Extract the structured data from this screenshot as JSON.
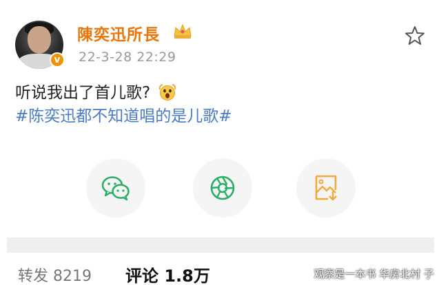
{
  "post": {
    "username": "陳奕迅所長",
    "timestamp": "22-3-28 22:29",
    "verified_mark": "v",
    "text": "听说我出了首儿歌?",
    "hashtag": "#陈奕迅都不知道唱的是儿歌#",
    "icons": {
      "vip": "crown-icon",
      "favorite": "star-icon",
      "emoji": "scream-emoji-icon"
    }
  },
  "share": [
    {
      "name": "wechat",
      "icon": "wechat-icon",
      "color": "#2aae67"
    },
    {
      "name": "moments",
      "icon": "moments-icon",
      "color": "#2aae67"
    },
    {
      "name": "save-image",
      "icon": "save-image-icon",
      "color": "#f2a93b"
    }
  ],
  "stats": {
    "repost": "转发 8219",
    "comment": "评论 1.8万"
  },
  "watermark": "观察是一本书 华房北村 子",
  "colors": {
    "username": "#e8760a",
    "hashtag": "#4a7bc0",
    "timestamp": "#999999",
    "verified": "#f29100"
  }
}
